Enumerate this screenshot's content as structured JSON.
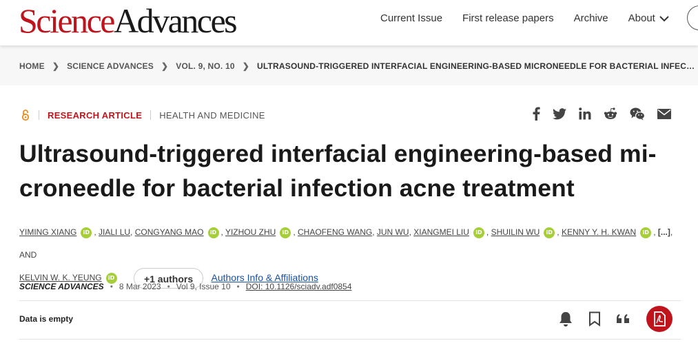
{
  "logo": {
    "part1": "Science",
    "part2": "Advances"
  },
  "nav": {
    "items": [
      "Current Issue",
      "First release papers",
      "Archive",
      "About"
    ]
  },
  "breadcrumb": {
    "items": [
      "HOME",
      "SCIENCE ADVANCES",
      "VOL. 9, NO. 10",
      "ULTRASOUND-TRIGGERED INTERFACIAL ENGINEERING-BASED MICRONEEDLE FOR BACTERIAL INFECTION ACNE TREATMENT"
    ]
  },
  "article": {
    "type": "RESEARCH ARTICLE",
    "subject": "HEALTH AND MEDICINE",
    "title_line1": "Ultrasound-triggered interfacial engineering-based mi-",
    "title_line2": "croneedle for bacterial infection acne treatment",
    "authors": [
      "YIMING XIANG",
      "JIALI LU",
      "CONGYANG MAO",
      "YIZHOU ZHU",
      "CHAOFENG WANG",
      "JUN WU",
      "XIANGMEI LIU",
      "SHUILIN WU",
      "KENNY Y. H. KWAN",
      "KELVIN W. K. YEUNG"
    ],
    "ellipsis": "[...]",
    "and": "AND",
    "orcid_label": "iD",
    "more_authors": "+1 authors",
    "affiliations_link": "Authors Info & Affiliations",
    "journal": "SCIENCE ADVANCES",
    "date": "8 Mar 2023",
    "volume": "Vol 9, Issue 10",
    "doi": "DOI: 10.1126/sciadv.adf0854",
    "data_status": "Data is empty"
  },
  "share_icons": [
    "facebook-icon",
    "twitter-icon",
    "linkedin-icon",
    "reddit-icon",
    "wechat-icon",
    "email-icon"
  ],
  "colors": {
    "brand_red": "#c0141c",
    "orcid_green": "#a6ce39",
    "open_access_orange": "#f08b1d",
    "link_blue": "#1a4fa0"
  }
}
